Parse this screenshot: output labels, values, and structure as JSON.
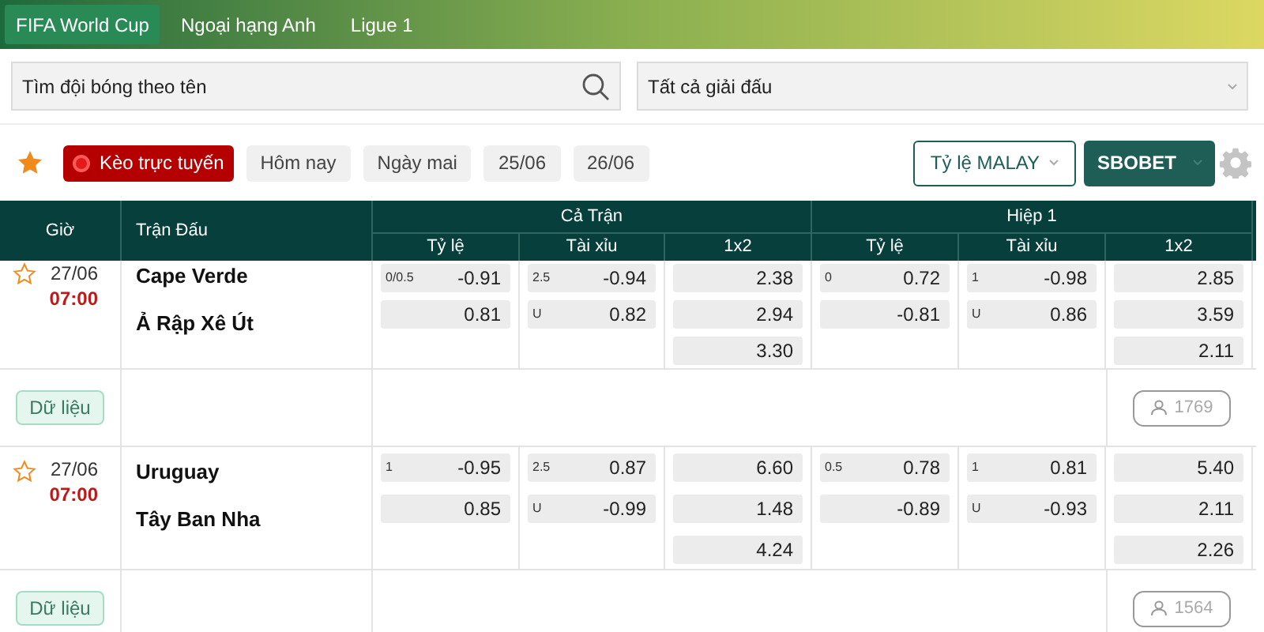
{
  "tabs": [
    {
      "label": "FIFA World Cup",
      "selected": true
    },
    {
      "label": "Ngoại hạng Anh",
      "selected": false
    },
    {
      "label": "Ligue 1",
      "selected": false
    }
  ],
  "search": {
    "placeholder": "Tìm đội bóng theo tên"
  },
  "league_select": {
    "value": "Tất cả giải đấu"
  },
  "filters": [
    {
      "label": "Kèo trực tuyến",
      "kind": "live"
    },
    {
      "label": "Hôm nay",
      "kind": "date"
    },
    {
      "label": "Ngày mai",
      "kind": "date"
    },
    {
      "label": "25/06",
      "kind": "date"
    },
    {
      "label": "26/06",
      "kind": "date"
    }
  ],
  "odds_type": "Tỷ lệ MALAY",
  "bookmaker": "SBOBET",
  "table": {
    "time_header": "Giờ",
    "match_header": "Trận Đấu",
    "groups": [
      {
        "label": "Cả Trận",
        "columns": [
          "Tỷ lệ",
          "Tài xỉu",
          "1x2"
        ]
      },
      {
        "label": "Hiệp 1",
        "columns": [
          "Tỷ lệ",
          "Tài xỉu",
          "1x2"
        ]
      }
    ],
    "matches": [
      {
        "favorite": false,
        "date": "27/06",
        "time": "07:00",
        "home": "Cape Verde",
        "away": "Ả Rập Xê Út",
        "data_button": "Dữ liệu",
        "viewers": "1769",
        "odds": [
          [
            {
              "tag": "0/0.5",
              "value": "-0.91"
            },
            {
              "value": "0.81"
            }
          ],
          [
            {
              "tag": "2.5",
              "value": "-0.94"
            },
            {
              "tag": "U",
              "value": "0.82"
            }
          ],
          [
            {
              "value": "2.38"
            },
            {
              "value": "2.94"
            },
            {
              "value": "3.30"
            }
          ],
          [
            {
              "tag": "0",
              "value": "0.72"
            },
            {
              "value": "-0.81"
            }
          ],
          [
            {
              "tag": "1",
              "value": "-0.98"
            },
            {
              "tag": "U",
              "value": "0.86"
            }
          ],
          [
            {
              "value": "2.85"
            },
            {
              "value": "3.59"
            },
            {
              "value": "2.11"
            }
          ]
        ]
      },
      {
        "favorite": false,
        "date": "27/06",
        "time": "07:00",
        "home": "Uruguay",
        "away": "Tây Ban Nha",
        "data_button": "Dữ liệu",
        "viewers": "1564",
        "odds": [
          [
            {
              "tag": "1",
              "value": "-0.95"
            },
            {
              "value": "0.85"
            }
          ],
          [
            {
              "tag": "2.5",
              "value": "0.87"
            },
            {
              "tag": "U",
              "value": "-0.99"
            }
          ],
          [
            {
              "value": "6.60"
            },
            {
              "value": "1.48"
            },
            {
              "value": "4.24"
            }
          ],
          [
            {
              "tag": "0.5",
              "value": "0.78"
            },
            {
              "value": "-0.89"
            }
          ],
          [
            {
              "tag": "1",
              "value": "0.81"
            },
            {
              "tag": "U",
              "value": "-0.93"
            }
          ],
          [
            {
              "value": "5.40"
            },
            {
              "value": "2.11"
            },
            {
              "value": "2.26"
            }
          ]
        ]
      }
    ]
  }
}
